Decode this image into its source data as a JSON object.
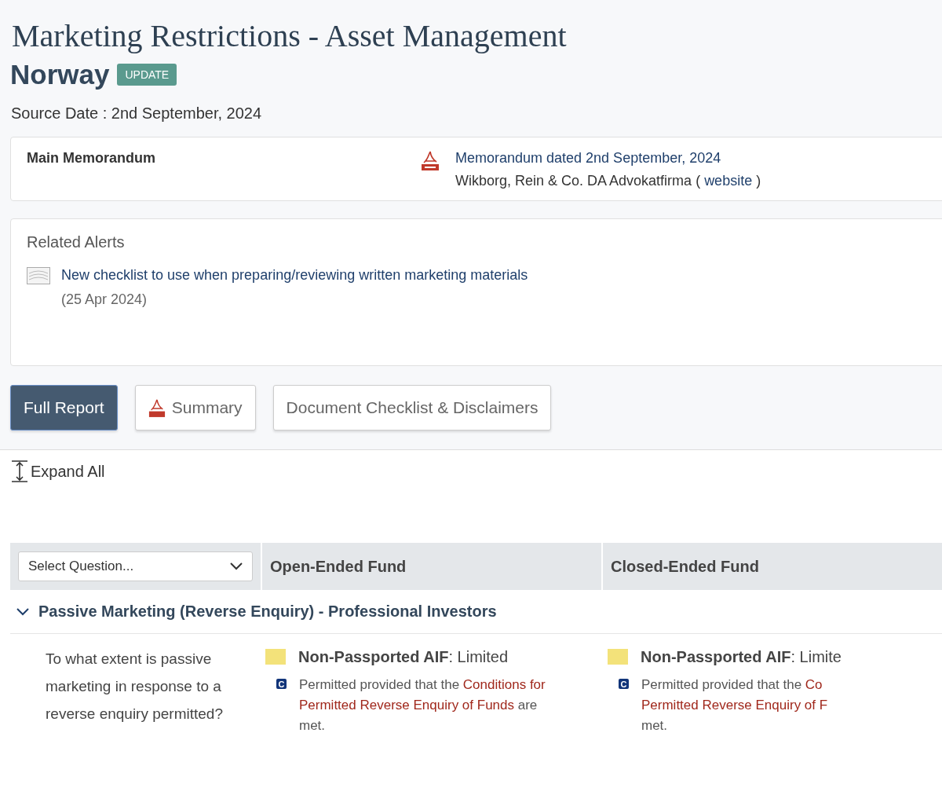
{
  "title": "Marketing Restrictions - Asset Management",
  "country": "Norway",
  "badge": "UPDATE",
  "source_date": "Source Date : 2nd September, 2024",
  "memorandum": {
    "label": "Main Memorandum",
    "link": "Memorandum dated 2nd September, 2024",
    "firm": "Wikborg, Rein & Co. DA Advokatfirma",
    "paren_open": "(",
    "website": "website",
    "paren_close": ")"
  },
  "related_alerts": {
    "heading": "Related Alerts",
    "items": [
      {
        "title": "New checklist to use when preparing/reviewing written marketing materials",
        "date": "(25 Apr 2024)"
      }
    ]
  },
  "buttons": [
    {
      "label": "Full Report",
      "selected": true,
      "pdf": false
    },
    {
      "label": "Summary",
      "selected": false,
      "pdf": true
    },
    {
      "label": "Document Checklist & Disclaimers",
      "selected": false,
      "pdf": false
    }
  ],
  "expand_all": "Expand All",
  "table": {
    "select": {
      "placeholder": "Select Question..."
    },
    "columns": [
      "Open-Ended Fund",
      "Closed-Ended Fund"
    ],
    "sections": [
      {
        "title": "Passive Marketing (Reverse Enquiry) - Professional Investors",
        "expanded": true,
        "rows": [
          {
            "question": "To what extent is passive marketing in response to a reverse enquiry permitted?",
            "cells": [
              {
                "color": "#f3e27a",
                "label": "Non-Passported AIF",
                "value": ": Limited",
                "note_badge": "C",
                "lines": [
                  [
                    {
                      "text": "Permitted provided that the ",
                      "link": false
                    },
                    {
                      "text": "Conditions for",
                      "link": true
                    }
                  ],
                  [
                    {
                      "text": "Permitted Reverse Enquiry of Funds",
                      "link": true
                    },
                    {
                      "text": " are",
                      "link": false
                    }
                  ],
                  [
                    {
                      "text": "met.",
                      "link": false
                    }
                  ]
                ]
              },
              {
                "color": "#f3e27a",
                "label": "Non-Passported AIF",
                "value": ": Limite",
                "note_badge": "C",
                "lines": [
                  [
                    {
                      "text": "Permitted provided that the ",
                      "link": false
                    },
                    {
                      "text": "Co",
                      "link": true
                    }
                  ],
                  [
                    {
                      "text": "Permitted Reverse Enquiry of F",
                      "link": true
                    }
                  ],
                  [
                    {
                      "text": "met.",
                      "link": false
                    }
                  ]
                ]
              }
            ]
          }
        ]
      }
    ]
  }
}
